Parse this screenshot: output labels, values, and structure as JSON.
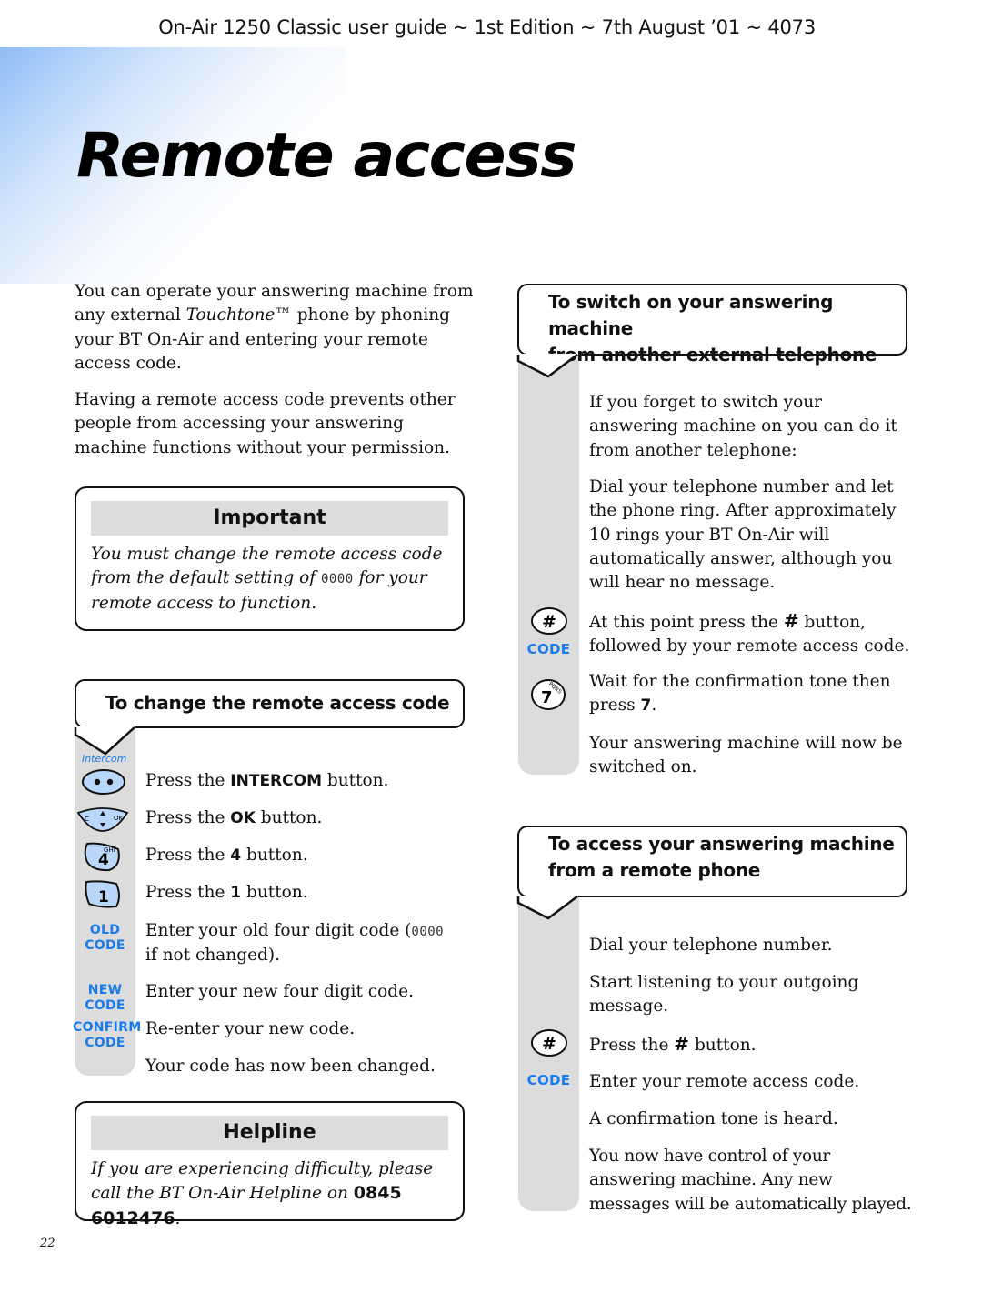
{
  "header": {
    "running_head": "On-Air 1250 Classic user guide ~ 1st Edition ~ 7th August ’01 ~ 4073",
    "title": "Remote access"
  },
  "intro": {
    "p1_a": "You can operate your answering machine from any external ",
    "p1_em": "Touchtone™",
    "p1_b": " phone by phoning your BT On-Air and entering your remote access code.",
    "p2": "Having a remote access code prevents other people from accessing your answering machine functions without your permission."
  },
  "important": {
    "heading": "Important",
    "text_a": "You must change the remote access code from the default setting of ",
    "code": "0000",
    "text_b": " for your remote access to function."
  },
  "change_code": {
    "heading": "To change the remote access code",
    "icon_label_intercom": "Intercom",
    "steps": [
      {
        "icon": "intercom-button-icon",
        "pre": "Press the ",
        "key": "INTERCOM",
        "post": " button."
      },
      {
        "icon": "ok-button-icon",
        "pre": "Press the ",
        "key": "OK",
        "post": " button."
      },
      {
        "icon": "key-4-icon",
        "pre": "Press the ",
        "key": "4",
        "post": " button."
      },
      {
        "icon": "key-1-icon",
        "pre": "Press the ",
        "key": "1",
        "post": " button."
      },
      {
        "label": [
          "OLD",
          "CODE"
        ],
        "pre": "Enter your old four digit code (",
        "code": "0000",
        "post": " if not changed)."
      },
      {
        "label": [
          "NEW",
          "CODE"
        ],
        "text": "Enter your new four digit code."
      },
      {
        "label": [
          "CONFIRM",
          "CODE"
        ],
        "text": "Re-enter your new code."
      },
      {
        "text": "Your code has now been changed."
      }
    ],
    "key_glyphs": {
      "ok_c": "C",
      "ok_ok": "OK",
      "k4": "4",
      "k4_letters": "GHI",
      "k1": "1"
    }
  },
  "helpline": {
    "heading": "Helpline",
    "text_a": "If you are experiencing difficulty, please call the BT On-Air Helpline on ",
    "number": "0845 6012476",
    "text_b": "."
  },
  "switch_on": {
    "heading_line1": "To switch on your answering machine",
    "heading_line2": "from another external telephone",
    "p1": "If you forget to switch your answering machine on you can do it from another telephone:",
    "p2": "Dial your telephone number and let the phone ring. After approximately 10 rings your BT On-Air will automatically answer, although you will hear no message.",
    "p3_pre": "At this point press the ",
    "p3_key": "#",
    "p3_post": " button, followed by your remote access code.",
    "p4_pre": "Wait for the confirmation tone then press ",
    "p4_key": "7",
    "p4_post": ".",
    "p5": "Your answering machine will now be switched on.",
    "code_label": "CODE",
    "hash_glyph": "#",
    "seven_glyph": "7",
    "seven_letters": "PQRS"
  },
  "remote_access": {
    "heading_line1": "To access your answering machine",
    "heading_line2": "from a remote phone",
    "p1": "Dial your telephone number.",
    "p2": "Start listening to your outgoing message.",
    "p3_pre": "Press the ",
    "p3_key": "#",
    "p3_post": " button.",
    "p4": "Enter your remote access code.",
    "p5": "A confirmation tone is heard.",
    "p6": "You now have control of your answering machine. Any new messages will be automatically played.",
    "code_label": "CODE",
    "hash_glyph": "#"
  },
  "footer": {
    "page_number": "22"
  },
  "colors": {
    "accent_blue": "#1a7bea",
    "key_fill": "#b9d7fb",
    "panel_grey": "#dcdcdc"
  }
}
